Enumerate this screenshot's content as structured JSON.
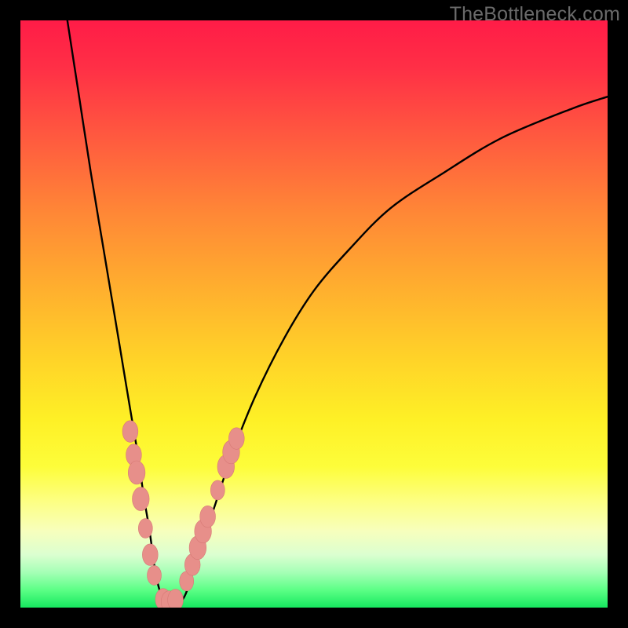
{
  "watermark": "TheBottleneck.com",
  "colors": {
    "frame": "#000000",
    "curve": "#000000",
    "marker_fill": "#e78f8a",
    "marker_stroke": "#d77a76"
  },
  "chart_data": {
    "type": "line",
    "title": "",
    "xlabel": "",
    "ylabel": "",
    "xlim": [
      0,
      100
    ],
    "ylim": [
      0,
      100
    ],
    "grid": false,
    "legend": false,
    "series": [
      {
        "name": "bottleneck-curve",
        "x": [
          8,
          10,
          12,
          14,
          16,
          18,
          19,
          20,
          21,
          22,
          23,
          24,
          25,
          26,
          28,
          30,
          33,
          36,
          40,
          45,
          50,
          56,
          63,
          72,
          82,
          94,
          100
        ],
        "y": [
          100,
          87,
          74,
          62,
          50,
          38,
          32,
          26,
          19,
          13,
          6,
          2,
          0,
          0,
          2,
          8,
          17,
          26,
          36,
          46,
          54,
          61,
          68,
          74,
          80,
          85,
          87
        ]
      }
    ],
    "markers": [
      {
        "x": 18.7,
        "y": 30.0,
        "size": 11
      },
      {
        "x": 19.3,
        "y": 26.0,
        "size": 11
      },
      {
        "x": 19.8,
        "y": 23.0,
        "size": 12
      },
      {
        "x": 20.5,
        "y": 18.5,
        "size": 12
      },
      {
        "x": 21.3,
        "y": 13.5,
        "size": 10
      },
      {
        "x": 22.1,
        "y": 9.0,
        "size": 11
      },
      {
        "x": 22.8,
        "y": 5.5,
        "size": 10
      },
      {
        "x": 24.3,
        "y": 1.4,
        "size": 11
      },
      {
        "x": 25.3,
        "y": 1.0,
        "size": 11
      },
      {
        "x": 26.4,
        "y": 1.3,
        "size": 11
      },
      {
        "x": 28.3,
        "y": 4.5,
        "size": 10
      },
      {
        "x": 29.3,
        "y": 7.3,
        "size": 11
      },
      {
        "x": 30.2,
        "y": 10.2,
        "size": 12
      },
      {
        "x": 31.1,
        "y": 13.0,
        "size": 12
      },
      {
        "x": 31.9,
        "y": 15.5,
        "size": 11
      },
      {
        "x": 33.6,
        "y": 20.0,
        "size": 10
      },
      {
        "x": 35.0,
        "y": 24.0,
        "size": 12
      },
      {
        "x": 35.9,
        "y": 26.5,
        "size": 12
      },
      {
        "x": 36.8,
        "y": 28.8,
        "size": 11
      }
    ]
  }
}
